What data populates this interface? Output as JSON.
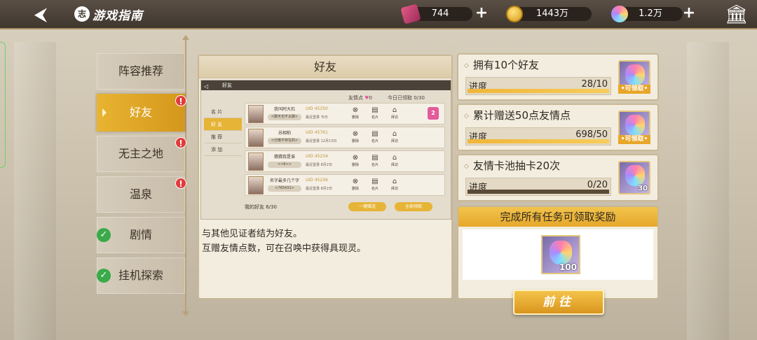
{
  "header": {
    "title": "游戏指南",
    "guide_icon_text": "志",
    "resources": [
      {
        "icon": "ticket-icon",
        "value": "744"
      },
      {
        "icon": "coin-icon",
        "value": "1443万"
      },
      {
        "icon": "gem-icon",
        "value": "1.2万"
      }
    ]
  },
  "menu": {
    "items": [
      {
        "label": "阵容推荐"
      },
      {
        "label": "好友"
      },
      {
        "label": "无主之地"
      },
      {
        "label": "温泉"
      },
      {
        "label": "剧情"
      },
      {
        "label": "挂机探索"
      }
    ]
  },
  "guide": {
    "title": "好友",
    "preview": {
      "tab_title": "好友",
      "stat_points": "友情点",
      "stat_points_value": "0",
      "stat_today": "今日已领取 0/30",
      "tabs": [
        "名 片",
        "好 友",
        "推 荐",
        "添 加"
      ],
      "rows": [
        {
          "name": "我叫阿大石",
          "tag": "<聊天也不太聊>",
          "uid": "UID 45250",
          "login": "最近登录 今日"
        },
        {
          "name": "苏相柏",
          "tag": "<分散不存在的>",
          "uid": "UID 45761",
          "login": "最近登录 12月13日"
        },
        {
          "name": "猜猜我是谁",
          "tag": "<<6>>",
          "uid": "UID 45234",
          "login": "最近登录 8月2日"
        },
        {
          "name": "名字最多几个字",
          "tag": "<765431>",
          "uid": "UID 45236",
          "login": "最近登录 8月2日"
        }
      ],
      "actions": [
        "删除",
        "名片",
        "拜访"
      ],
      "footer_count": "我的好友 6/30",
      "btn_send": "一键赠送",
      "btn_claim": "全部领取"
    },
    "description": [
      "与其他见证者结为好友。",
      "互赠友情点数，可在召唤中获得具现灵。"
    ]
  },
  "tasks": [
    {
      "title": "拥有10个好友",
      "progress_label": "进度",
      "progress_text": "28/10",
      "progress": 1.0,
      "reward_status": "•可领取•"
    },
    {
      "title": "累计赠送50点友情点",
      "progress_label": "进度",
      "progress_text": "698/50",
      "progress": 1.0,
      "reward_status": "•可领取•"
    },
    {
      "title": "友情卡池抽卡20次",
      "progress_label": "进度",
      "progress_text": "0/20",
      "progress": 0.0,
      "reward_qty": "30"
    }
  ],
  "final_reward": {
    "title": "完成所有任务可领取奖励",
    "qty": "100",
    "go_label": "前往"
  }
}
